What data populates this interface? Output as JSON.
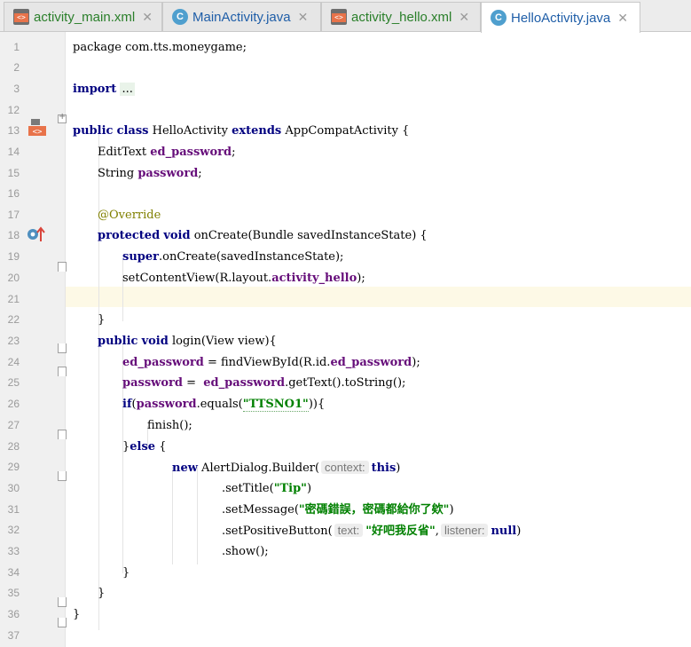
{
  "tabs": [
    {
      "label": "activity_main.xml",
      "kind": "xml",
      "active": false
    },
    {
      "label": "MainActivity.java",
      "kind": "java",
      "active": false
    },
    {
      "label": "activity_hello.xml",
      "kind": "xml",
      "active": false
    },
    {
      "label": "HelloActivity.java",
      "kind": "java",
      "active": true
    }
  ],
  "icons": {
    "xml_file": "xml-file-icon",
    "java_class": "java-class-icon",
    "close": "close-icon",
    "layout_gutter": "xml-layout-gutter-icon",
    "override_gutter": "override-method-gutter-icon"
  },
  "colors": {
    "keyword": "#000080",
    "field": "#660e7a",
    "string": "#008000",
    "annotation": "#808000",
    "caret_line": "#fdf9e6"
  },
  "caret_line_number": "21",
  "lines": {
    "l1": {
      "num": "1",
      "code": "package com.tts.moneygame;"
    },
    "l2": {
      "num": "2"
    },
    "l3": {
      "num": "3",
      "kw": "import",
      "folded": "..."
    },
    "l12": {
      "num": "12"
    },
    "l13": {
      "num": "13",
      "kw1": "public",
      "kw2": "class",
      "name": "HelloActivity",
      "kw3": "extends",
      "rest": "AppCompatActivity {"
    },
    "l14": {
      "num": "14",
      "type": "EditText",
      "field": "ed_password",
      "end": ";"
    },
    "l15": {
      "num": "15",
      "type": "String",
      "field": "password",
      "end": ";"
    },
    "l16": {
      "num": "16"
    },
    "l17": {
      "num": "17",
      "annotation": "@Override"
    },
    "l18": {
      "num": "18",
      "kw1": "protected",
      "kw2": "void",
      "rest": "onCreate(Bundle savedInstanceState) {"
    },
    "l19": {
      "num": "19",
      "kw": "super",
      "rest": ".onCreate(savedInstanceState);"
    },
    "l20": {
      "num": "20",
      "pre": "setContentView(R.layout.",
      "field": "activity_hello",
      "end": ");"
    },
    "l21": {
      "num": "21"
    },
    "l22": {
      "num": "22",
      "code": "}"
    },
    "l23": {
      "num": "23",
      "kw1": "public",
      "kw2": "void",
      "rest": "login(View view){"
    },
    "l24": {
      "num": "24",
      "field": "ed_password",
      "mid": " = findViewById(R.id.",
      "field2": "ed_password",
      "end": ");"
    },
    "l25": {
      "num": "25",
      "field": "password",
      "mid": " =  ",
      "field2": "ed_password",
      "end": ".getText().toString();"
    },
    "l26": {
      "num": "26",
      "kw": "if",
      "pre": "(",
      "field": "password",
      "mid": ".equals(",
      "str": "\"TTSNO1\"",
      "end": ")){"
    },
    "l27": {
      "num": "27",
      "code": "finish();"
    },
    "l28": {
      "num": "28",
      "pre": "}",
      "kw": "else",
      "end": " {"
    },
    "l29": {
      "num": "29",
      "kw": "new",
      "pre": " AlertDialog.Builder(",
      "hint": "context:",
      "kw2": "this",
      "end": ")"
    },
    "l30": {
      "num": "30",
      "pre": ".setTitle(",
      "str": "\"Tip\"",
      "end": ")"
    },
    "l31": {
      "num": "31",
      "pre": ".setMessage(",
      "str": "\"密碼錯誤，密碼都給你了欸\"",
      "end": ")"
    },
    "l32": {
      "num": "32",
      "pre": ".setPositiveButton(",
      "hint": "text:",
      "str": "\"好吧我反省\"",
      "mid": ",",
      "hint2": "listener:",
      "kw": "null",
      "end": ")"
    },
    "l33": {
      "num": "33",
      "code": ".show();"
    },
    "l34": {
      "num": "34",
      "code": "}"
    },
    "l35": {
      "num": "35",
      "code": "}"
    },
    "l36": {
      "num": "36",
      "code": "}"
    },
    "l37": {
      "num": "37"
    }
  }
}
